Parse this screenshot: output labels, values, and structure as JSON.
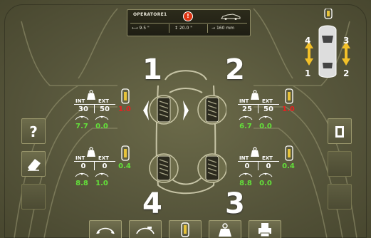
{
  "header": {
    "title": "OPERATORE1",
    "warning_glyph": "!",
    "m1": "9.5 \"",
    "m2": "20.0 \"",
    "m3": "160 mm"
  },
  "corners": {
    "fl_number": "1",
    "fr_number": "2",
    "rr_number": "3",
    "rl_number": "4"
  },
  "mini_car_numbers": {
    "tl": "4",
    "tr": "3",
    "bl": "1",
    "br": "2"
  },
  "panels": {
    "fl": {
      "int_label": "INT",
      "ext_label": "EXT",
      "int": "30",
      "ext": "50",
      "total": "1.0",
      "bottom_left": "7.7",
      "bottom_right": "0.0"
    },
    "fr": {
      "int_label": "INT",
      "ext_label": "EXT",
      "int": "25",
      "ext": "50",
      "total": "1.0",
      "bottom_left": "6.7",
      "bottom_right": "0.0"
    },
    "rl": {
      "int_label": "INT",
      "ext_label": "EXT",
      "int": "0",
      "ext": "0",
      "total": "0.4",
      "bottom_left": "8.8",
      "bottom_right": "1.0"
    },
    "rr": {
      "int_label": "INT",
      "ext_label": "EXT",
      "int": "0",
      "ext": "0",
      "total": "0.4",
      "bottom_left": "8.8",
      "bottom_right": "0.0"
    }
  },
  "colors": {
    "red": "#e62020",
    "green": "#63e03a",
    "bg": "#5f5e41"
  },
  "icons": {
    "left_buttons": [
      "question-icon",
      "eraser-icon"
    ],
    "right_buttons": [
      "exit-icon"
    ],
    "bottom_bar": [
      "rim-clip-icon",
      "rim-adhesive-icon",
      "tyre-icon",
      "weight-icon",
      "printer-icon"
    ]
  }
}
